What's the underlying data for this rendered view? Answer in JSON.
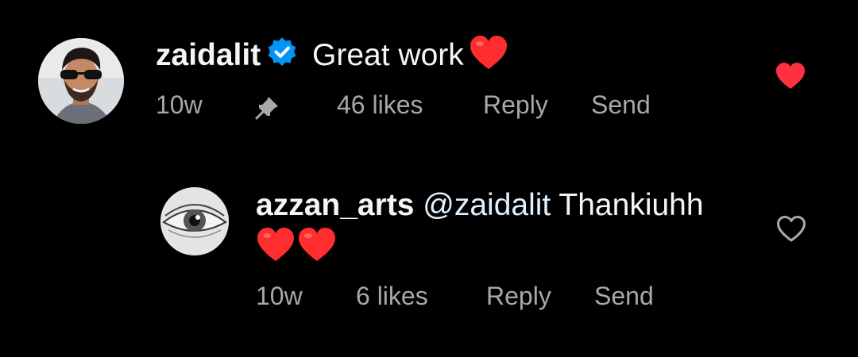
{
  "comments": [
    {
      "username": "zaidalit",
      "verified": true,
      "text": "Great work",
      "emoji": "heart",
      "time": "10w",
      "pinned": true,
      "likes": "46 likes",
      "reply_label": "Reply",
      "send_label": "Send",
      "liked": true,
      "avatar_icon": "user-photo-sunglasses"
    },
    {
      "username": "azzan_arts",
      "mention": "@zaidalit",
      "text": "Thankiuhh",
      "emoji_line": [
        "heart",
        "heart"
      ],
      "time": "10w",
      "likes": "6 likes",
      "reply_label": "Reply",
      "send_label": "Send",
      "liked": false,
      "avatar_icon": "eye-sketch"
    }
  ],
  "colors": {
    "background": "#000000",
    "primary_text": "#f5f5f5",
    "secondary_text": "#a8a8a8",
    "mention": "#e0f1ff",
    "verified_badge": "#0095f6",
    "like_red": "#ff3040"
  }
}
